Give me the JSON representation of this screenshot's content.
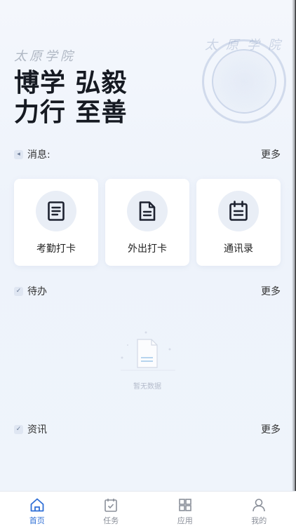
{
  "hero": {
    "school_name": "太原学院",
    "motto_line1": "博学 弘毅",
    "motto_line2": "力行 至善",
    "seal_text": "太原学院"
  },
  "messages": {
    "label": "消息:",
    "more": "更多",
    "icon": "speaker-icon"
  },
  "quick_actions": [
    {
      "label": "考勤打卡",
      "icon": "attendance-list-icon"
    },
    {
      "label": "外出打卡",
      "icon": "document-icon"
    },
    {
      "label": "通讯录",
      "icon": "contacts-calendar-icon"
    }
  ],
  "todo": {
    "label": "待办",
    "more": "更多",
    "empty_text": "暂无数据"
  },
  "news": {
    "label": "资讯",
    "more": "更多"
  },
  "tabbar": {
    "items": [
      {
        "label": "首页",
        "icon": "home-icon",
        "active": true
      },
      {
        "label": "任务",
        "icon": "task-icon",
        "active": false
      },
      {
        "label": "应用",
        "icon": "apps-grid-icon",
        "active": false
      },
      {
        "label": "我的",
        "icon": "profile-icon",
        "active": false
      }
    ]
  },
  "colors": {
    "accent": "#2f6fd6",
    "icon_dark": "#1d2230",
    "background": "#f1f5fb"
  }
}
